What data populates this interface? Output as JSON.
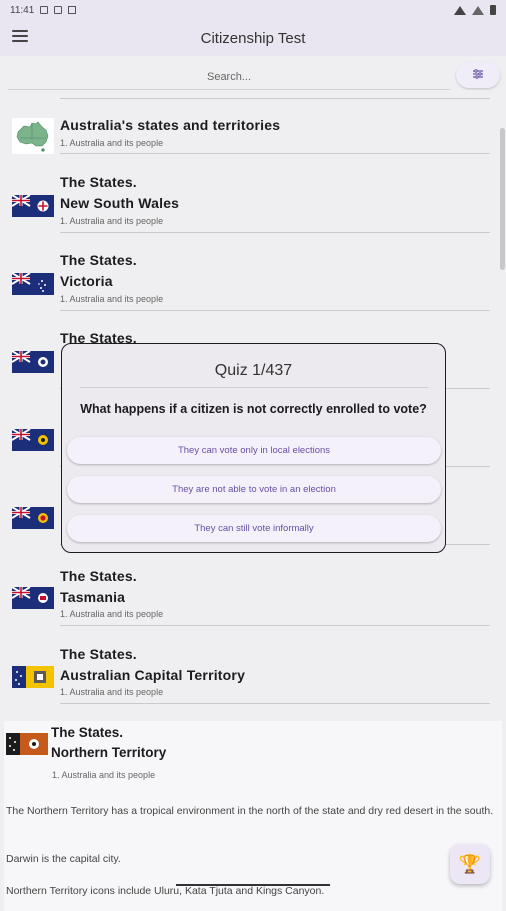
{
  "status_bar": {
    "time": "11:41"
  },
  "app_bar": {
    "title": "Citizenship Test"
  },
  "search": {
    "placeholder": "Search..."
  },
  "list": {
    "items": [
      {
        "title1": "Australia's states and territories",
        "title2": "",
        "subtitle": "1. Australia and its people"
      },
      {
        "title1": "The States.",
        "title2": "New South Wales",
        "subtitle": "1. Australia and its people"
      },
      {
        "title1": "The States.",
        "title2": "Victoria",
        "subtitle": "1. Australia and its people"
      },
      {
        "title1": "The States.",
        "title2": "",
        "subtitle": ""
      },
      {
        "title1": "",
        "title2": "",
        "subtitle": ""
      },
      {
        "title1": "",
        "title2": "",
        "subtitle": ""
      },
      {
        "title1": "The States.",
        "title2": "Tasmania",
        "subtitle": "1. Australia and its people"
      },
      {
        "title1": "The States.",
        "title2": "Australian Capital Territory",
        "subtitle": "1. Australia and its people"
      }
    ]
  },
  "quiz": {
    "title": "Quiz 1/437",
    "question": "What happens if a citizen is not correctly enrolled to vote?",
    "answers": [
      "They can vote only in local elections",
      "They are not able to vote in an election",
      "They can still vote informally"
    ]
  },
  "expanded": {
    "title1": "The States.",
    "title2": "Northern Territory",
    "subtitle": "1. Australia and its people",
    "paragraphs": [
      "The Northern Territory has a tropical environment in the north of the state and dry red desert in the south.",
      "Darwin is the capital city.",
      "Northern Territory icons include Uluru, Kata Tjuta and Kings Canyon."
    ]
  },
  "icons": {
    "menu": "menu-icon",
    "filter": "filter-icon",
    "trophy": "trophy-icon"
  },
  "colors": {
    "accent": "#6750a4",
    "appbar": "#e9e6f1"
  }
}
